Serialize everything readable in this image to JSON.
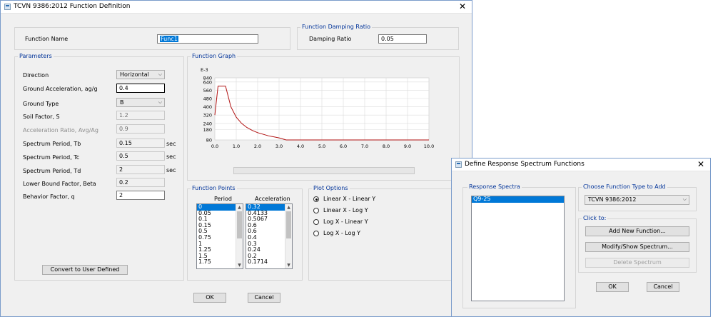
{
  "func_def": {
    "title": "TCVN 9386:2012 Function Definition",
    "function_name_label": "Function Name",
    "function_name_value": "Func1",
    "damping_group": "Function Damping Ratio",
    "damping_label": "Damping Ratio",
    "damping_value": "0.05",
    "parameters": {
      "group": "Parameters",
      "direction_label": "Direction",
      "direction_value": "Horizontal",
      "ground_accel_label": "Ground Acceleration, ag/g",
      "ground_accel_value": "0.4",
      "ground_type_label": "Ground Type",
      "ground_type_value": "B",
      "soil_factor_label": "Soil Factor, S",
      "soil_factor_value": "1.2",
      "accel_ratio_label": "Acceleration Ratio, Avg/Ag",
      "accel_ratio_value": "0.9",
      "tb_label": "Spectrum Period, Tb",
      "tb_value": "0.15",
      "tc_label": "Spectrum Period, Tc",
      "tc_value": "0.5",
      "td_label": "Spectrum Period, Td",
      "td_value": "2",
      "beta_label": "Lower Bound Factor, Beta",
      "beta_value": "0.2",
      "q_label": "Behavior Factor, q",
      "q_value": "2",
      "sec_unit": "sec",
      "convert_button": "Convert to User Defined"
    },
    "graph_group": "Function Graph",
    "function_points": {
      "group": "Function Points",
      "period_header": "Period",
      "accel_header": "Acceleration",
      "periods": [
        "0",
        "0.05",
        "0.1",
        "0.15",
        "0.5",
        "0.75",
        "1",
        "1.25",
        "1.5",
        "1.75"
      ],
      "accelerations": [
        "0.32",
        "0.4133",
        "0.5067",
        "0.6",
        "0.6",
        "0.4",
        "0.3",
        "0.24",
        "0.2",
        "0.1714"
      ]
    },
    "plot_options": {
      "group": "Plot Options",
      "options": [
        "Linear X - Linear Y",
        "Linear X - Log Y",
        "Log X - Linear Y",
        "Log X - Log Y"
      ],
      "selected": "Linear X - Linear Y"
    },
    "ok_button": "OK",
    "cancel_button": "Cancel"
  },
  "spectrum_dialog": {
    "title": "Define Response Spectrum Functions",
    "response_spectra_group": "Response Spectra",
    "spectra": [
      "Q9-25"
    ],
    "choose_group": "Choose  Function Type to Add",
    "type_value": "TCVN 9386:2012",
    "click_group": "Click to:",
    "add_button": "Add New Function...",
    "modify_button": "Modify/Show Spectrum...",
    "delete_button": "Delete Spectrum",
    "ok_button": "OK",
    "cancel_button": "Cancel"
  },
  "chart_data": {
    "type": "line",
    "title": "",
    "ylabel": "E-3",
    "xlabel": "",
    "xlim": [
      0,
      10
    ],
    "ylim": [
      80,
      840
    ],
    "x_ticks": [
      "0.0",
      "1.0",
      "2.0",
      "3.0",
      "4.0",
      "5.0",
      "6.0",
      "7.0",
      "8.0",
      "9.0",
      "10.0"
    ],
    "y_ticks": [
      "80",
      "180",
      "240",
      "320",
      "400",
      "480",
      "560",
      "640",
      "840"
    ],
    "grid": true,
    "line_color": "#b01010",
    "x": [
      0,
      0.05,
      0.1,
      0.15,
      0.5,
      0.75,
      1,
      1.25,
      1.5,
      1.75,
      2,
      2.5,
      3,
      3.33,
      4,
      5,
      6,
      7,
      8,
      9,
      10
    ],
    "y": [
      320,
      413.3,
      506.7,
      600,
      600,
      400,
      300,
      240,
      200,
      171.4,
      150,
      120,
      100,
      80,
      80,
      80,
      80,
      80,
      80,
      80,
      80
    ]
  }
}
